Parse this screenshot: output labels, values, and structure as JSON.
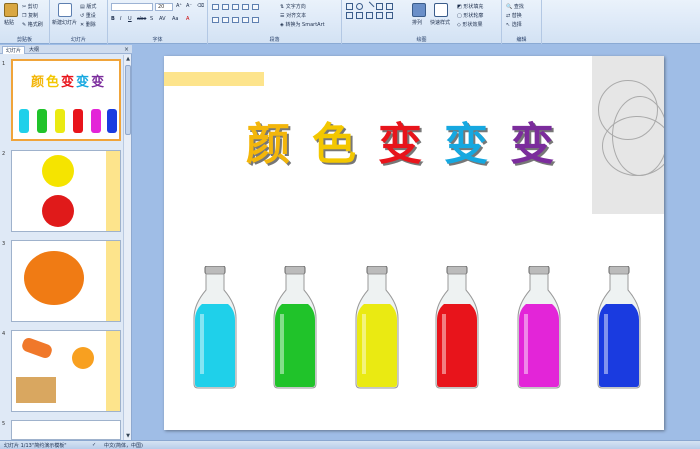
{
  "ribbon": {
    "groups": [
      {
        "label": "剪贴板",
        "items": [
          "粘贴",
          "剪切",
          "复制",
          "格式刷"
        ]
      },
      {
        "label": "幻灯片",
        "items": [
          "新建幻灯片",
          "版式",
          "重设",
          "删除"
        ]
      },
      {
        "label": "字体",
        "font_size": "20"
      },
      {
        "label": "段落",
        "items": [
          "文字方向",
          "对齐文本",
          "转换为 SmartArt"
        ]
      },
      {
        "label": "绘图",
        "items": [
          "排列",
          "快速样式",
          "形状填充",
          "形状轮廓",
          "形状效果"
        ]
      },
      {
        "label": "编辑",
        "items": [
          "查找",
          "替换",
          "选择"
        ]
      }
    ]
  },
  "leftpane": {
    "tabs": [
      "幻灯片",
      "大纲"
    ],
    "close": "×",
    "thumb_numbers": [
      "1",
      "2",
      "3",
      "4",
      "5"
    ]
  },
  "slide": {
    "title_chars": [
      {
        "ch": "颜",
        "color": "#f3b60b"
      },
      {
        "ch": "色",
        "color": "#f3c700"
      },
      {
        "ch": "变",
        "color": "#e8141b"
      },
      {
        "ch": "变",
        "color": "#16a8e0"
      },
      {
        "ch": "变",
        "color": "#7b2c9c"
      }
    ],
    "bottles": [
      {
        "color": "#1fd0ea"
      },
      {
        "color": "#20c32a"
      },
      {
        "color": "#eaea12"
      },
      {
        "color": "#e8141b"
      },
      {
        "color": "#e325d8"
      },
      {
        "color": "#1a3be0"
      }
    ]
  },
  "statusbar": {
    "slide_info": "幻灯片 1/13",
    "theme": "\"简约演示模板\"",
    "language": "中文(简体，中国)"
  },
  "colors": {
    "ribbon": "#d3e2f4",
    "workspace": "#9fbde6",
    "selection": "#f0a43a"
  }
}
